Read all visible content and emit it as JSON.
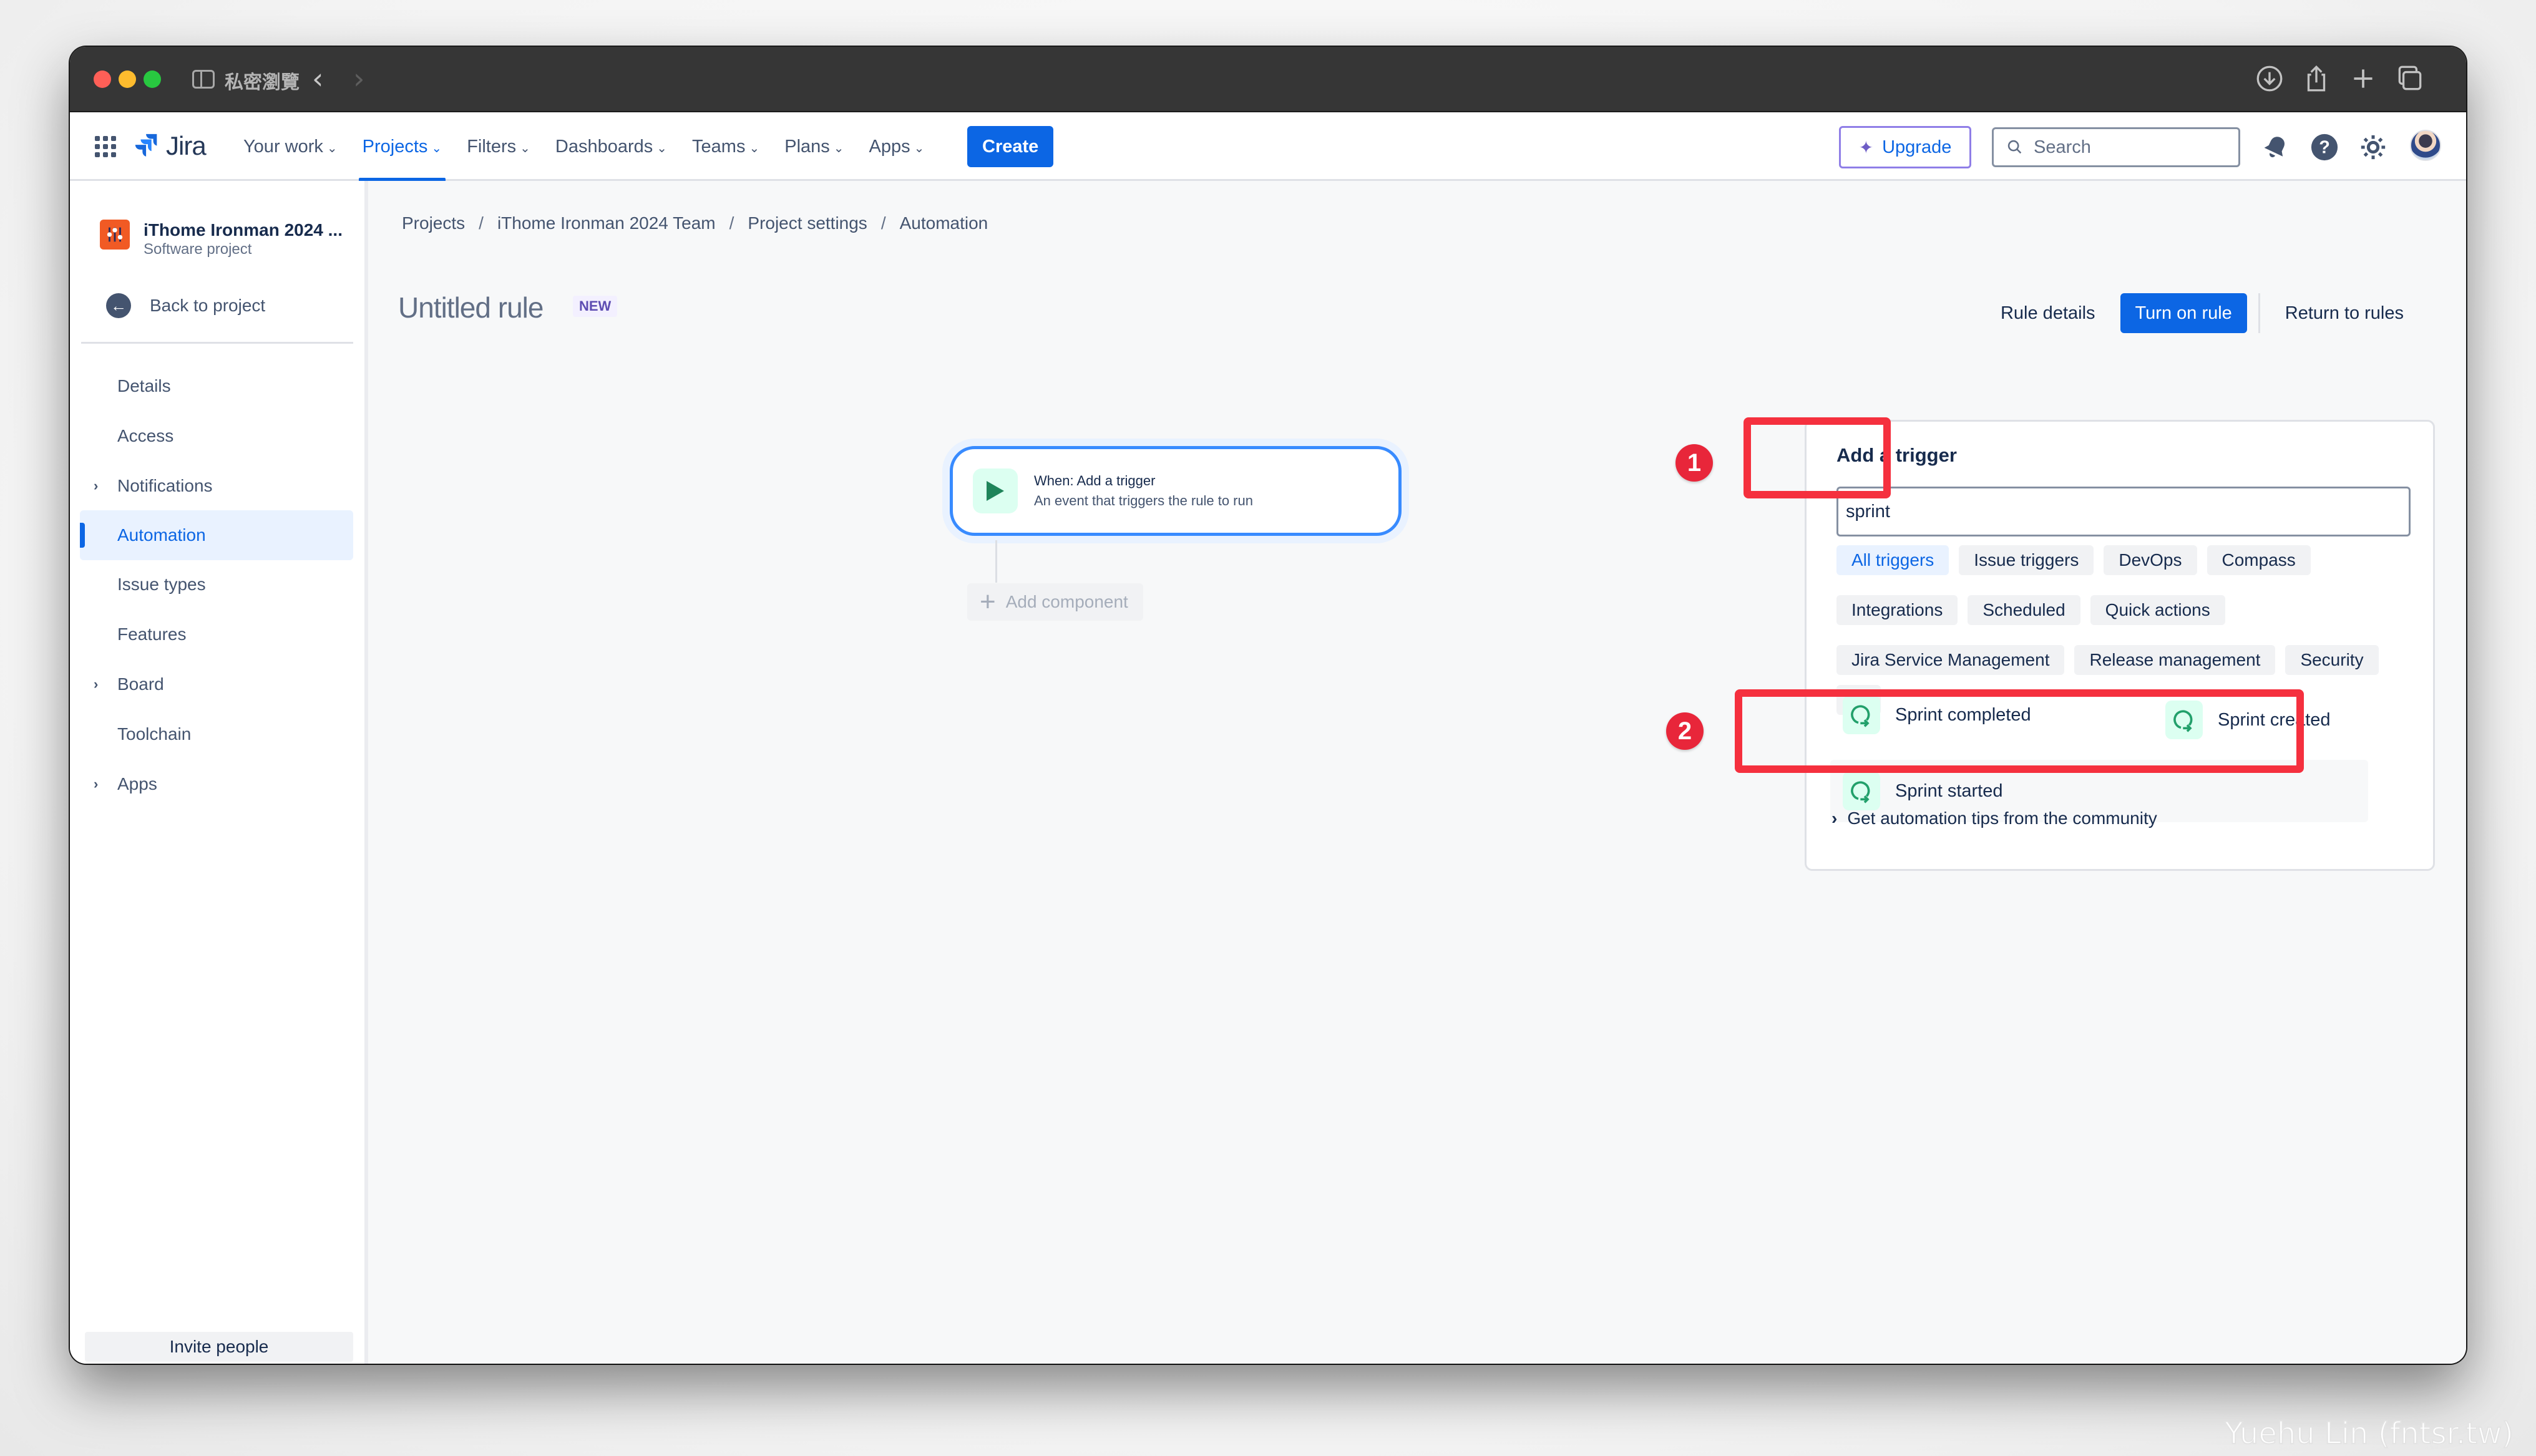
{
  "browser": {
    "private_label": "私密瀏覽",
    "icons": [
      "sidebar-toggle-icon",
      "back-icon",
      "forward-icon",
      "download-icon",
      "share-icon",
      "new-tab-icon",
      "tabs-overview-icon"
    ]
  },
  "nav": {
    "logo_text": "Jira",
    "items": [
      {
        "label": "Your work",
        "active": false
      },
      {
        "label": "Projects",
        "active": true
      },
      {
        "label": "Filters",
        "active": false
      },
      {
        "label": "Dashboards",
        "active": false
      },
      {
        "label": "Teams",
        "active": false
      },
      {
        "label": "Plans",
        "active": false
      },
      {
        "label": "Apps",
        "active": false
      }
    ],
    "create_label": "Create",
    "upgrade_label": "Upgrade",
    "search_placeholder": "Search",
    "icons": [
      "notifications-icon",
      "help-icon",
      "settings-icon",
      "avatar"
    ]
  },
  "sidebar": {
    "project_name": "iThome Ironman 2024 ...",
    "project_type": "Software project",
    "back_label": "Back to project",
    "items": [
      {
        "label": "Details",
        "expandable": false,
        "active": false
      },
      {
        "label": "Access",
        "expandable": false,
        "active": false
      },
      {
        "label": "Notifications",
        "expandable": true,
        "active": false
      },
      {
        "label": "Automation",
        "expandable": false,
        "active": true
      },
      {
        "label": "Issue types",
        "expandable": false,
        "active": false
      },
      {
        "label": "Features",
        "expandable": false,
        "active": false
      },
      {
        "label": "Board",
        "expandable": true,
        "active": false
      },
      {
        "label": "Toolchain",
        "expandable": false,
        "active": false
      },
      {
        "label": "Apps",
        "expandable": true,
        "active": false
      }
    ],
    "invite_label": "Invite people"
  },
  "main": {
    "breadcrumb": [
      "Projects",
      "iThome Ironman 2024 Team",
      "Project settings",
      "Automation"
    ],
    "title": "Untitled rule",
    "badge": "NEW",
    "actions": {
      "rule_details": "Rule details",
      "turn_on": "Turn on rule",
      "return": "Return to rules"
    },
    "trigger_node": {
      "title": "When: Add a trigger",
      "subtitle": "An event that triggers the rule to run"
    },
    "add_component_label": "Add component"
  },
  "trigger_panel": {
    "title": "Add a trigger",
    "search_value": "sprint",
    "chips_rows": [
      [
        "All triggers",
        "Issue triggers",
        "DevOps",
        "Compass"
      ],
      [
        "Integrations",
        "Scheduled",
        "Quick actions"
      ],
      [
        "Jira Service Management",
        "Release management",
        "Security"
      ]
    ],
    "active_chip": "All triggers",
    "more_label": "•••",
    "results": [
      "Sprint completed",
      "Sprint created",
      "Sprint started"
    ],
    "community_label": "Get automation tips from the community"
  },
  "annotations": {
    "one": "1",
    "two": "2",
    "color": "#f5303e"
  },
  "watermark": "Yuehu Lin (fntsr.tw)",
  "colors": {
    "brand_blue": "#0c66e4",
    "trigger_green": "#22a06b",
    "upgrade_purple": "#8f7ee7"
  }
}
